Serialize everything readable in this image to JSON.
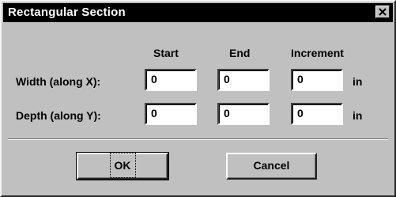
{
  "window": {
    "title": "Rectangular Section"
  },
  "columns": {
    "start": "Start",
    "end": "End",
    "increment": "Increment"
  },
  "rows": [
    {
      "label": "Width (along X):",
      "start": "0",
      "end": "0",
      "increment": "0",
      "unit": "in"
    },
    {
      "label": "Depth (along Y):",
      "start": "0",
      "end": "0",
      "increment": "0",
      "unit": "in"
    }
  ],
  "buttons": {
    "ok": "OK",
    "cancel": "Cancel"
  },
  "icons": {
    "close": "close-icon"
  }
}
